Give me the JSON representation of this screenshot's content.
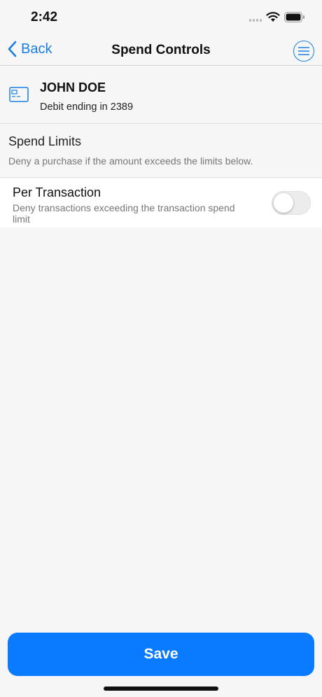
{
  "status_bar": {
    "time": "2:42",
    "icons": [
      "signal-icon",
      "wifi-icon",
      "battery-icon"
    ]
  },
  "nav": {
    "back_label": "Back",
    "title": "Spend Controls",
    "menu_icon": "menu-lines-icon"
  },
  "card": {
    "icon": "card-icon",
    "holder_name": "JOHN DOE",
    "description": "Debit ending in 2389"
  },
  "spend_limits": {
    "title": "Spend Limits",
    "description": "Deny a purchase if the amount exceeds the limits below."
  },
  "per_transaction": {
    "title": "Per Transaction",
    "description": "Deny transactions exceeding the transaction spend limit",
    "enabled": false
  },
  "save_label": "Save",
  "colors": {
    "accent": "#1a7fe0",
    "save_button": "#0a7bff",
    "background": "#f6f6f6"
  }
}
